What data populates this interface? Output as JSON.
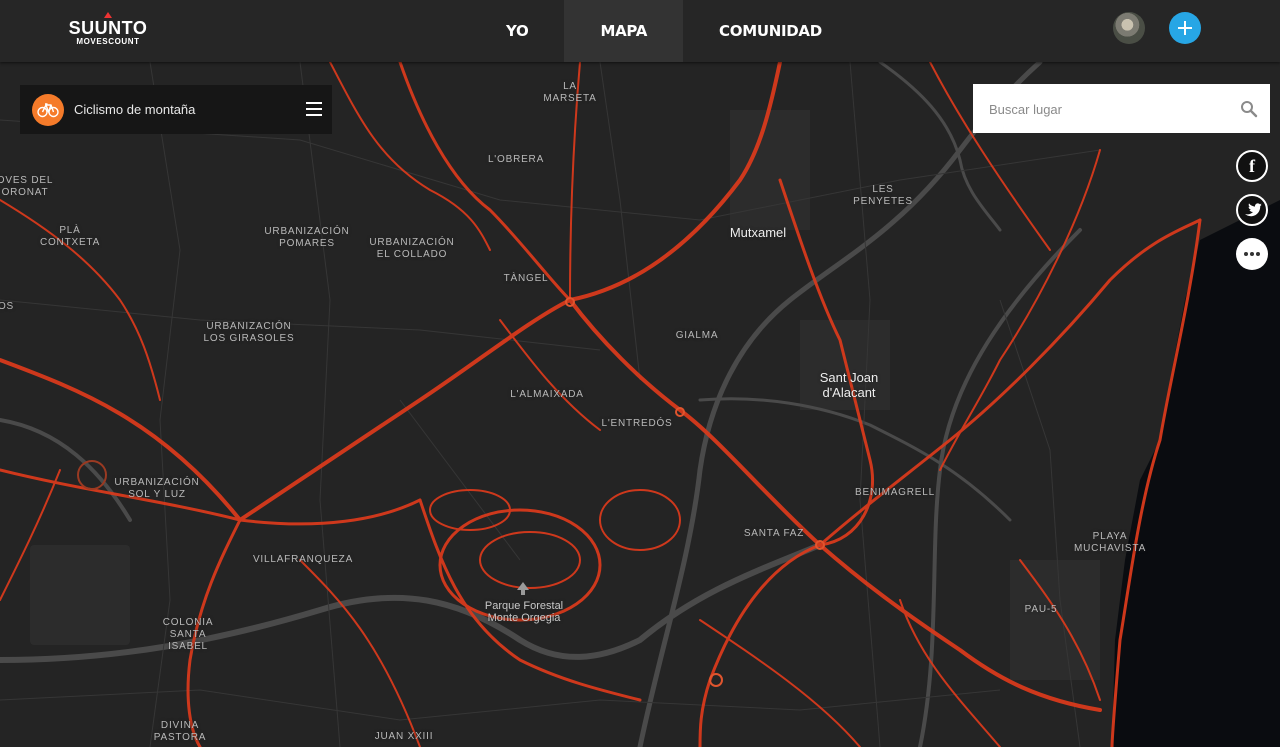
{
  "header": {
    "logo_brand": "SUUNTO",
    "logo_sub": "MOVESCOUNT",
    "tabs": [
      {
        "label": "YO",
        "active": false
      },
      {
        "label": "MAPA",
        "active": true
      },
      {
        "label": "COMUNIDAD",
        "active": false
      }
    ],
    "accent_color": "#27a6e5"
  },
  "sport_selector": {
    "label": "Ciclismo de montaña",
    "icon": "bicycle-icon",
    "icon_color": "#f57b2a"
  },
  "search": {
    "placeholder": "Buscar lugar",
    "value": ""
  },
  "social": [
    "facebook-icon",
    "twitter-icon",
    "more-icon"
  ],
  "map": {
    "heat_color": "#d83a1c",
    "sea_color": "#0a0c10",
    "labels": {
      "marseta": "LA\nMARSETA",
      "obrera": "L'OBRERA",
      "moves": "OVES DEL\nORONAT",
      "contxeta": "PLÀ\nCONTXETA",
      "pomares": "URBANIZACIÓN\nPOMARES",
      "collado": "URBANIZACIÓN\nEL COLLADO",
      "tangel": "TÀNGEL",
      "girasoles": "URBANIZACIÓN\nLOS GIRASOLES",
      "gialma": "GIALMA",
      "almaixada": "L'ALMAIXADA",
      "entredos": "L'ENTREDÓS",
      "penyetes": "LES\nPENYETES",
      "solyluz": "URBANIZACIÓN\nSOL Y LUZ",
      "villafranqueza": "VILLAFRANQUEZA",
      "benimagrell": "BENIMAGRELL",
      "santafaz": "SANTA FAZ",
      "muchavista": "PLAYA\nMUCHAVISTA",
      "pau5": "PAU-5",
      "santaisabel": "COLONIA\nSANTA\nISABEL",
      "divina": "DIVINA\nPASTORA",
      "juanxxiii": "JUAN XXIII",
      "os": "OS"
    },
    "towns": {
      "mutxamel": "Mutxamel",
      "santjoan": "Sant Joan\nd'Alacant"
    },
    "poi": {
      "parque": "Parque Forestal\nMonte Orgegia"
    }
  }
}
